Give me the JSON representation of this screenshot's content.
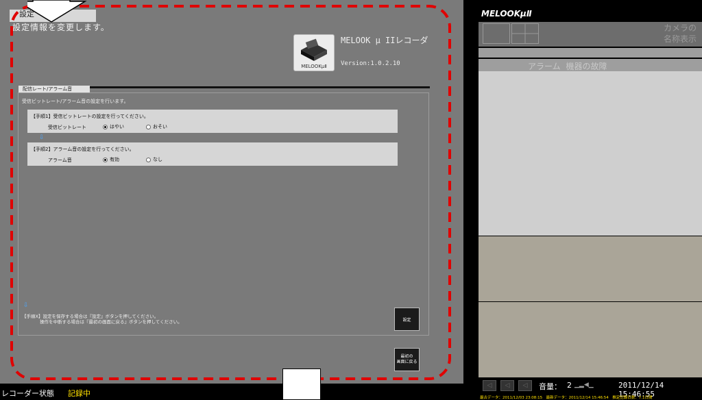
{
  "settings": {
    "tab_label": "設定",
    "description": "設定情報を変更します。",
    "logo_caption": "MELOOKμⅡ",
    "app_title": "MELOOK μ IIレコーダ",
    "app_version": "Version:1.0.2.10"
  },
  "section": {
    "tab_label": "配信レート/アラーム音",
    "description": "受信ビットレート/アラーム音の設定を行います。",
    "step1": {
      "title": "【手順1】受信ビットレートの設定を行ってください。",
      "label": "受信ビットレート",
      "options": [
        {
          "label": "はやい",
          "selected": true
        },
        {
          "label": "おそい",
          "selected": false
        }
      ]
    },
    "step2": {
      "title": "【手順2】アラーム音の設定を行ってください。",
      "label": "アラーム音",
      "options": [
        {
          "label": "有効",
          "selected": true
        },
        {
          "label": "なし",
          "selected": false
        }
      ]
    },
    "footer_note_1": "【手順X】設定を保存する場合は『設定』ボタンを押してください。",
    "footer_note_2": "操作を中断する場合は『最初の画面に戻る』ボタンを押してください。"
  },
  "buttons": {
    "set": "設定",
    "back_line1": "最初の",
    "back_line2": "画面に戻る"
  },
  "status": {
    "recorder_label": "レコーダー状態",
    "recorder_value": "記録中"
  },
  "right_pane": {
    "brand": "MELOOKμⅡ",
    "camera_name_line1": "カメラの",
    "camera_name_line2": "名称表示",
    "alarm_tab": "アラーム",
    "fault_tab": "機器の故障",
    "volume_label": "音量：",
    "volume_value": "2",
    "clock": "2011/12/14 15:46:55",
    "data_range": "最古データ：2011/12/03 23:08:15　最新データ：2011/12/14 15:46:54　推定記録日数：7.1日間"
  },
  "colors": {
    "panel": "#7a7a7a",
    "highlight_dashed": "#e00000",
    "status_value": "#ffe000",
    "step_arrow": "#4aa8ff"
  },
  "icons": [
    "down-arrow-pointer-icon",
    "app-logo-icon",
    "blue-down-arrow-icon",
    "radio-icon",
    "volume-icon",
    "playback-icon"
  ]
}
